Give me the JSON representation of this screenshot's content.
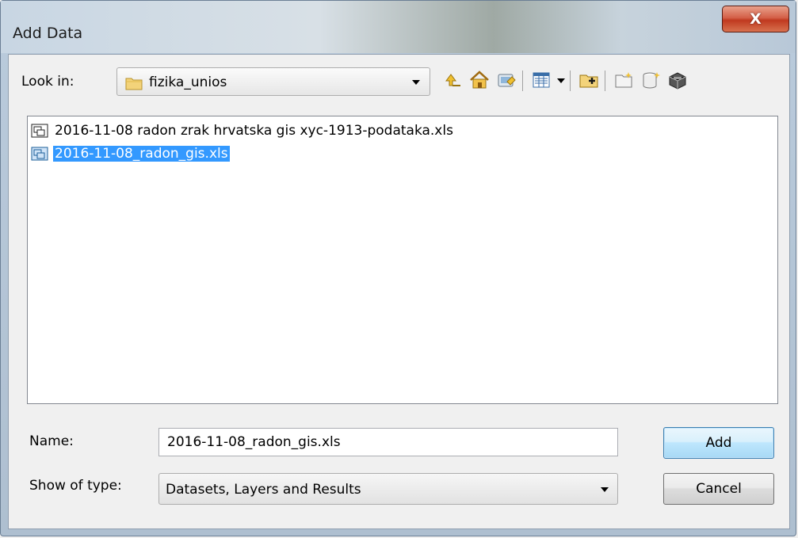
{
  "window": {
    "title": "Add Data",
    "close_label": "X"
  },
  "lookin": {
    "label": "Look in:",
    "value": "fizika_unios"
  },
  "toolbar": {
    "icons": [
      "up-one-level-icon",
      "home-icon",
      "database-connection-icon",
      "view-list-icon",
      "connect-to-folder-icon",
      "new-folder-icon",
      "new-database-icon",
      "toolbox-icon"
    ]
  },
  "files": [
    {
      "name": "2016-11-08 radon zrak hrvatska gis xyc-1913-podataka.xls",
      "selected": false
    },
    {
      "name": "2016-11-08_radon_gis.xls",
      "selected": true
    }
  ],
  "name_field": {
    "label": "Name:",
    "value": "2016-11-08_radon_gis.xls"
  },
  "type_field": {
    "label": "Show of type:",
    "value": "Datasets, Layers and Results"
  },
  "buttons": {
    "add": "Add",
    "cancel": "Cancel"
  },
  "colors": {
    "selection": "#3399ff",
    "close_red": "#c0391f"
  }
}
